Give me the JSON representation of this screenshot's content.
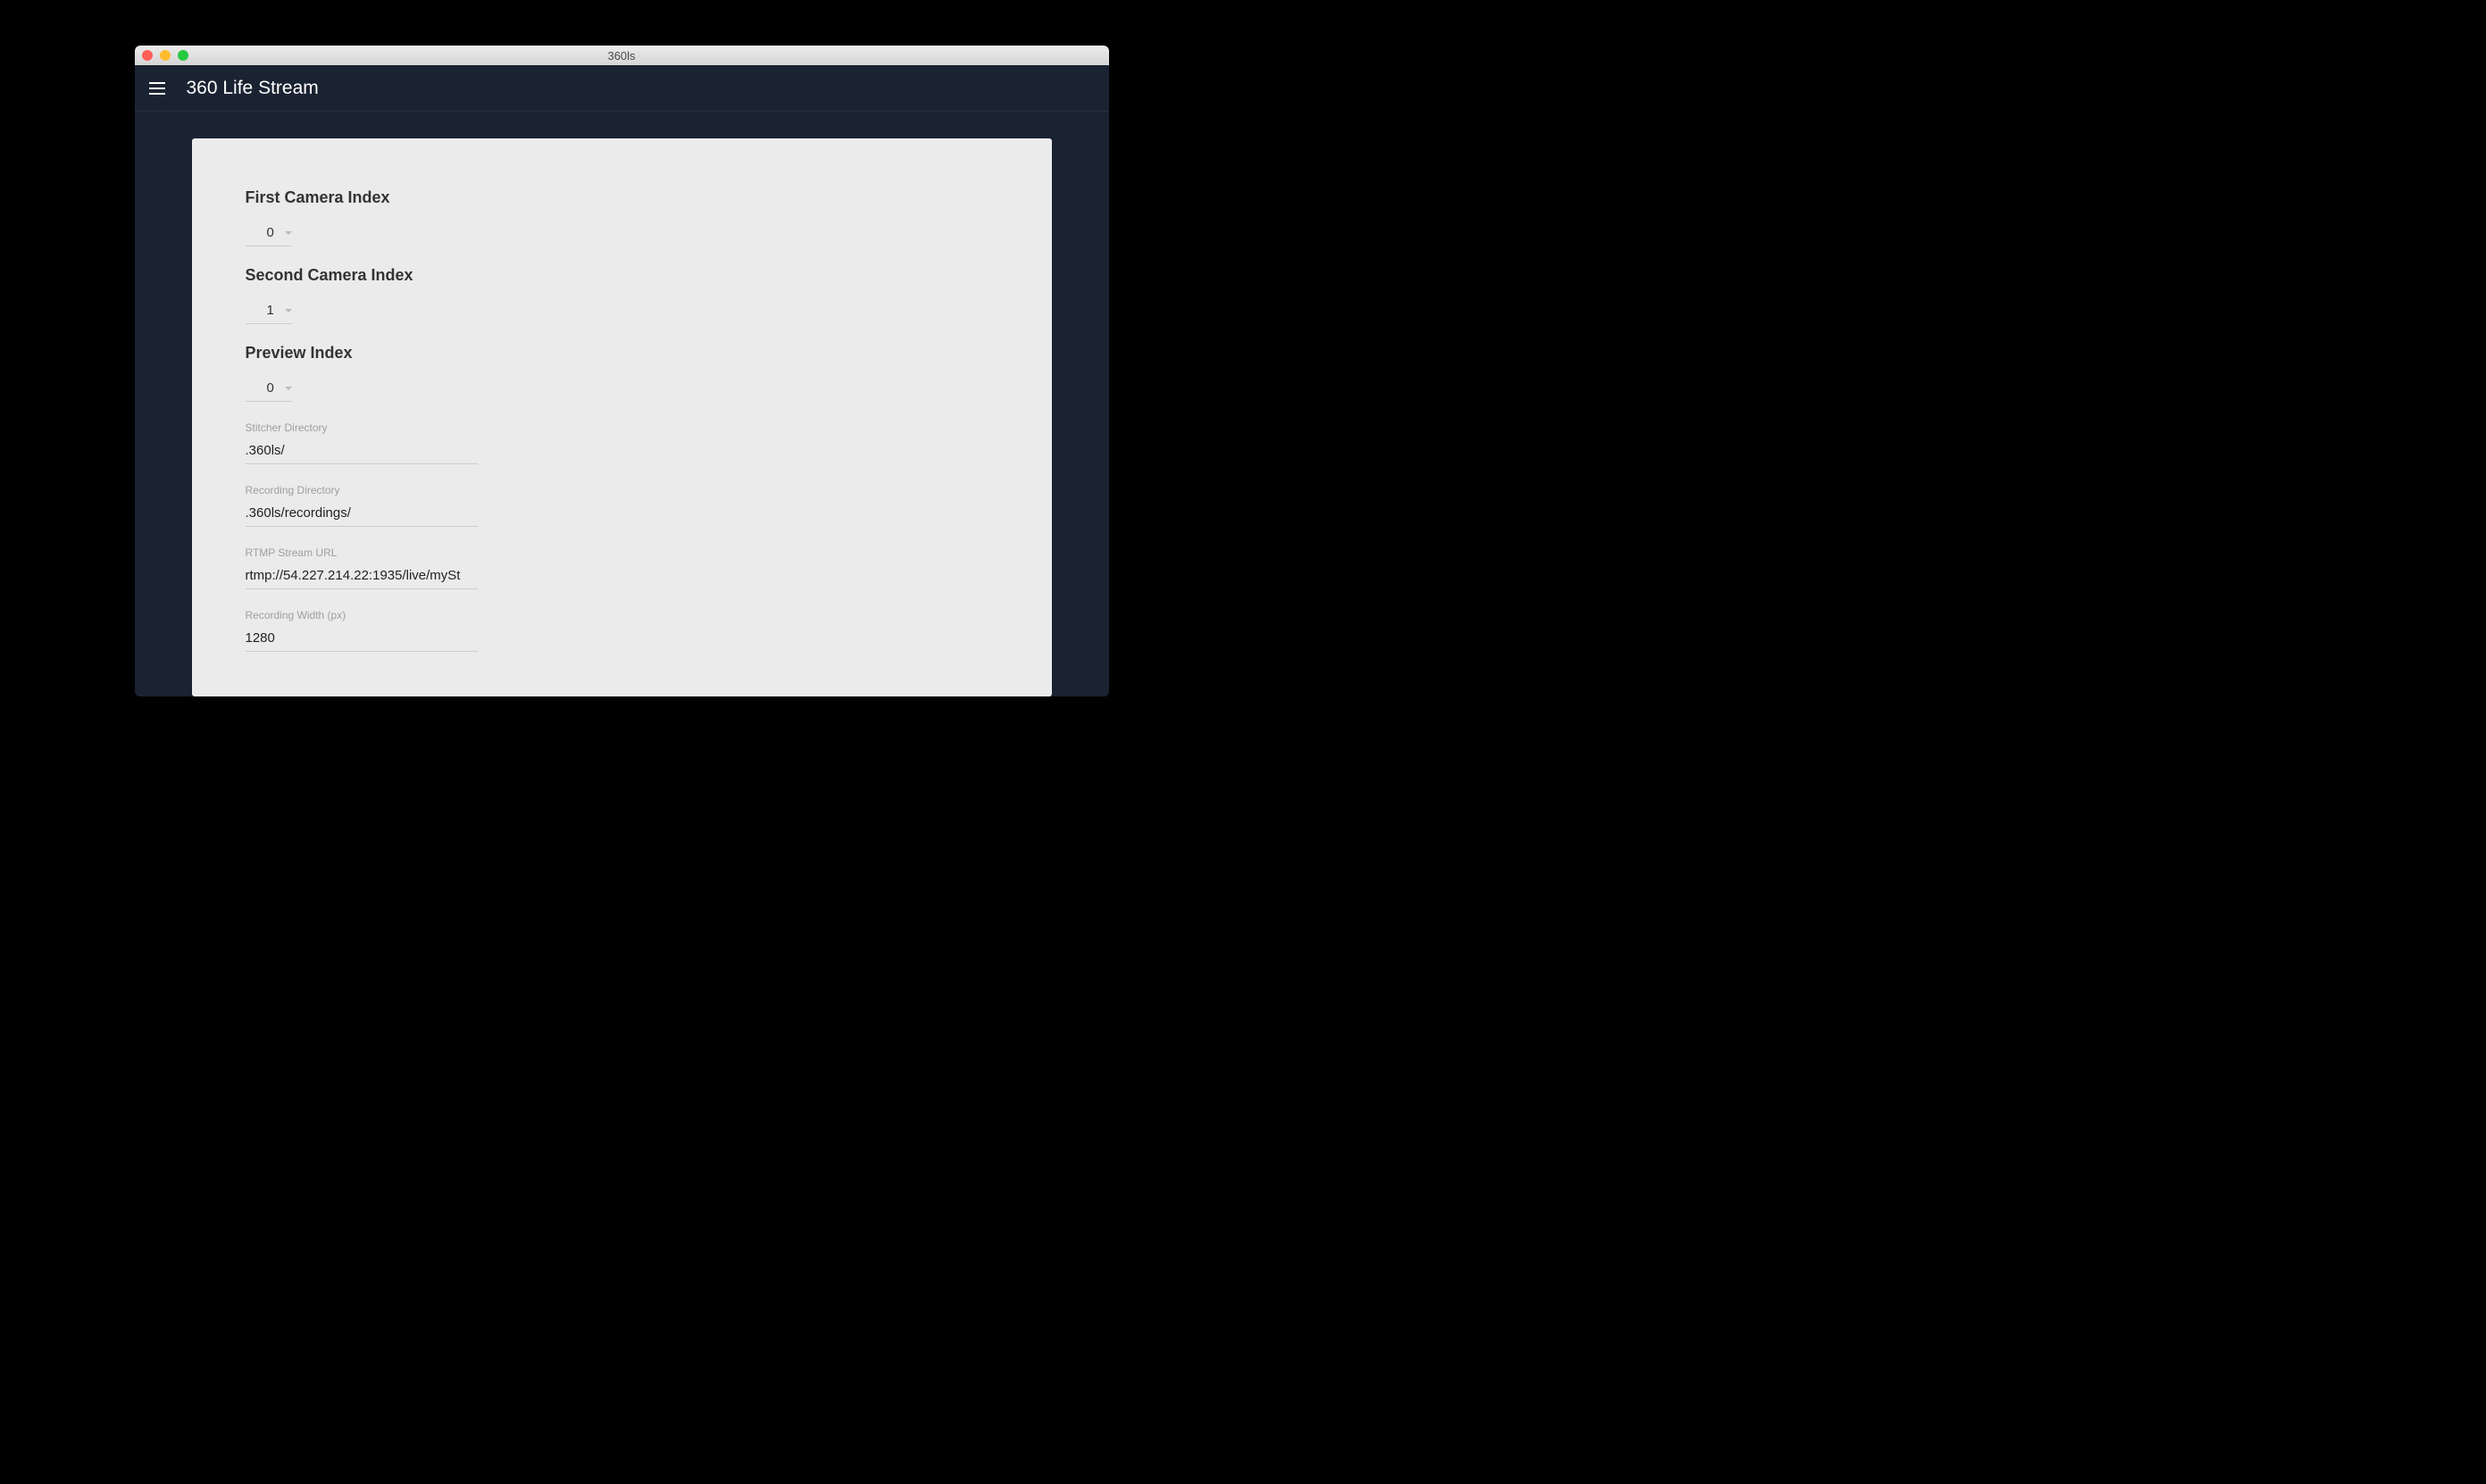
{
  "window": {
    "title": "360ls"
  },
  "header": {
    "title": "360 Life Stream"
  },
  "form": {
    "firstCamera": {
      "label": "First Camera Index",
      "value": "0"
    },
    "secondCamera": {
      "label": "Second Camera Index",
      "value": "1"
    },
    "previewIndex": {
      "label": "Preview Index",
      "value": "0"
    },
    "stitcherDir": {
      "label": "Stitcher Directory",
      "value": ".360ls/"
    },
    "recordingDir": {
      "label": "Recording Directory",
      "value": ".360ls/recordings/"
    },
    "rtmpUrl": {
      "label": "RTMP Stream URL",
      "value": "rtmp://54.227.214.22:1935/live/mySt"
    },
    "recordingWidth": {
      "label": "Recording Width (px)",
      "value": "1280"
    }
  }
}
